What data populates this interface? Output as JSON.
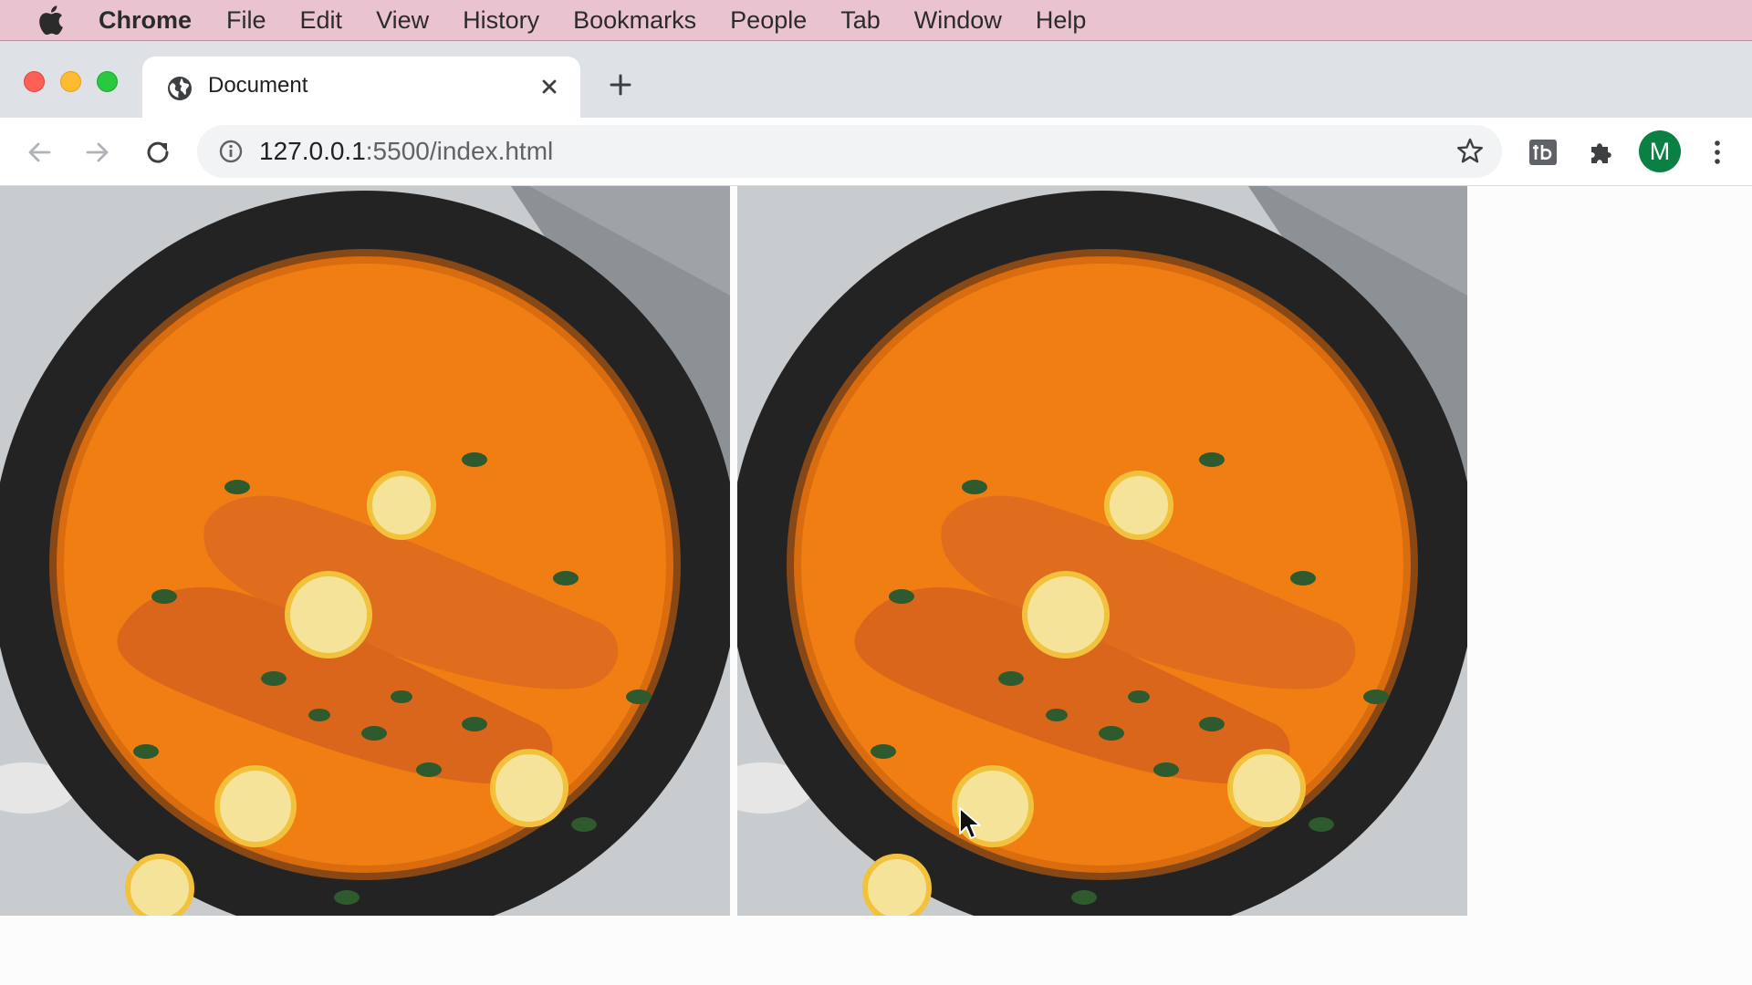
{
  "menubar": {
    "app_name": "Chrome",
    "items": [
      "File",
      "Edit",
      "View",
      "History",
      "Bookmarks",
      "People",
      "Tab",
      "Window",
      "Help"
    ],
    "color": "#eac3d1"
  },
  "tab": {
    "title": "Document",
    "favicon": "globe-icon"
  },
  "toolbar": {
    "url_host": "127.0.0.1",
    "url_path": ":5500/index.html",
    "avatar_initial": "M",
    "avatar_color": "#0b8043"
  },
  "page": {
    "images": [
      {
        "alt": "salmon-curry-photo"
      },
      {
        "alt": "salmon-curry-photo"
      }
    ]
  }
}
